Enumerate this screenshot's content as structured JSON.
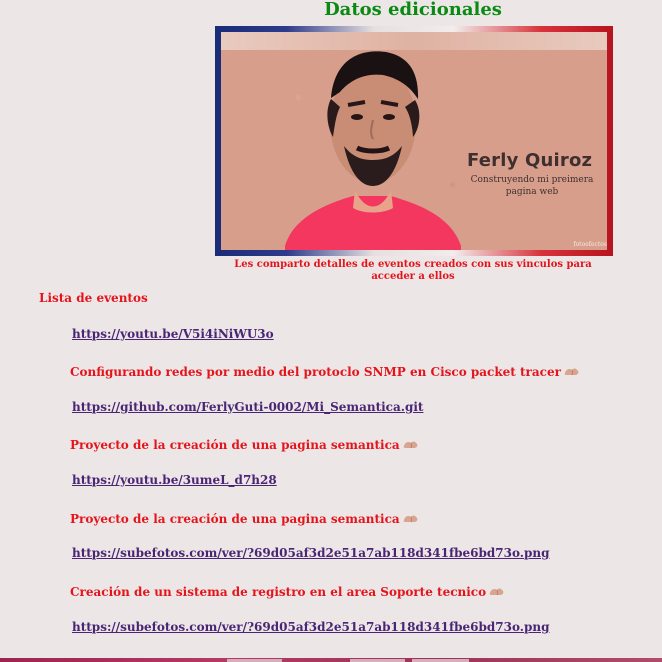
{
  "header": {
    "title": "Datos edicionales"
  },
  "profile": {
    "name": "Ferly Quiroz",
    "subtitle": "Construyendo mi preimera pagina web",
    "watermark": "fotoefectos",
    "caption": "Les comparto detalles de eventos creados con sus vinculos para acceder a ellos"
  },
  "events": {
    "heading": "Lista de eventos",
    "link_1": "https://youtu.be/V5i4iNiWU3o",
    "title_1": "Configurando redes por medio del protoclo SNMP en Cisco packet tracer",
    "link_2": "https://github.com/FerlyGuti-0002/Mi_Semantica.git",
    "title_2": "Proyecto de la creación de una pagina semantica",
    "link_3": "https://youtu.be/3umeL_d7h28",
    "title_3": "Proyecto de la creación de una pagina semantica",
    "link_4": "https://subefotos.com/ver/?69d05af3d2e51a7ab118d341fbe6bd73o.png",
    "title_4": "Creación de un sistema de registro en el area Soporte tecnico",
    "link_5": "https://subefotos.com/ver/?69d05af3d2e51a7ab118d341fbe6bd73o.png"
  },
  "icons": {
    "emoji": "flexed-biceps-icon"
  },
  "colors": {
    "title_green": "#0a8a12",
    "text_red": "#e5141b",
    "link_purple": "#4a2574",
    "background": "#ece6e7"
  }
}
